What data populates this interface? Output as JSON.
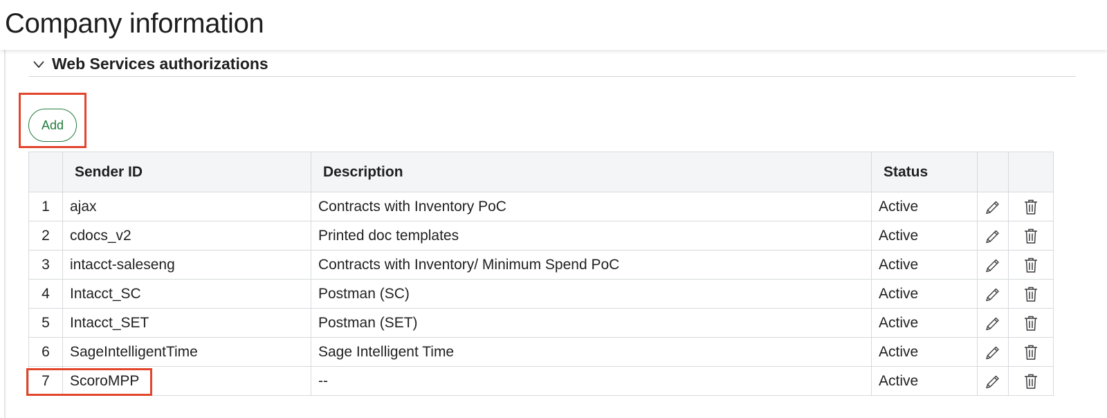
{
  "header": {
    "title": "Company information"
  },
  "section": {
    "title": "Web Services authorizations",
    "expanded": true
  },
  "toolbar": {
    "add_label": "Add"
  },
  "table": {
    "columns": {
      "index": "",
      "sender_id": "Sender ID",
      "description": "Description",
      "status": "Status",
      "edit": "",
      "delete": ""
    },
    "rows": [
      {
        "num": "1",
        "sender_id": "ajax",
        "description": "Contracts with Inventory PoC",
        "status": "Active"
      },
      {
        "num": "2",
        "sender_id": "cdocs_v2",
        "description": "Printed doc templates",
        "status": "Active"
      },
      {
        "num": "3",
        "sender_id": "intacct-saleseng",
        "description": "Contracts with Inventory/ Minimum Spend PoC",
        "status": "Active"
      },
      {
        "num": "4",
        "sender_id": "Intacct_SC",
        "description": "Postman (SC)",
        "status": "Active"
      },
      {
        "num": "5",
        "sender_id": "Intacct_SET",
        "description": "Postman (SET)",
        "status": "Active"
      },
      {
        "num": "6",
        "sender_id": "SageIntelligentTime",
        "description": "Sage Intelligent Time",
        "status": "Active"
      },
      {
        "num": "7",
        "sender_id": "ScoroMPP",
        "description": "--",
        "status": "Active"
      }
    ],
    "row_icons": [
      "pencil-icon",
      "trash-icon"
    ]
  },
  "colors": {
    "accent_green": "#1f7a3a",
    "highlight_red": "#e2452b",
    "header_bg": "#f4f5f7",
    "grid_border": "#d7d9dd"
  }
}
